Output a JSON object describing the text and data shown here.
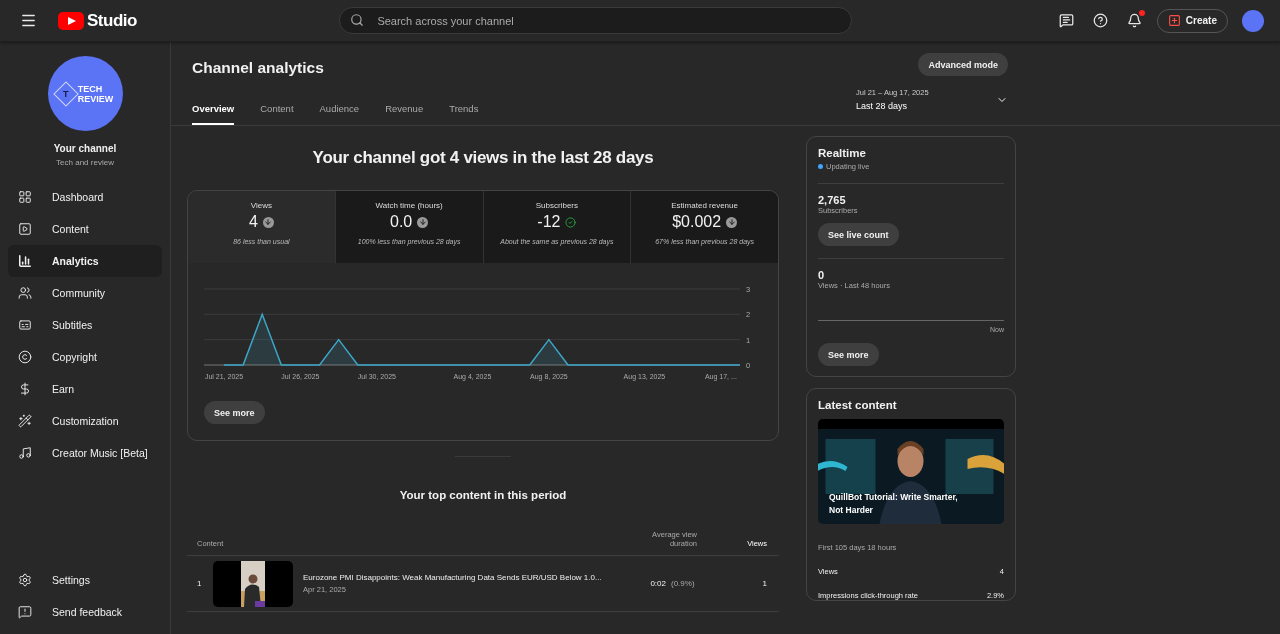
{
  "topbar": {
    "logo_text": "Studio",
    "search": {
      "placeholder": "Search across your channel"
    },
    "notification_dot": true,
    "create_button": "Create"
  },
  "sidebar": {
    "avatar_mark": "T",
    "avatar_lines": [
      "TECH",
      "REVIEW"
    ],
    "channel_title": "Your channel",
    "channel_subtitle": "Tech and review",
    "items": [
      {
        "label": "Dashboard",
        "selected": false
      },
      {
        "label": "Content",
        "selected": false
      },
      {
        "label": "Analytics",
        "selected": true
      },
      {
        "label": "Community",
        "selected": false
      },
      {
        "label": "Subtitles",
        "selected": false
      },
      {
        "label": "Copyright",
        "selected": false
      },
      {
        "label": "Earn",
        "selected": false
      },
      {
        "label": "Customization",
        "selected": false
      },
      {
        "label": "Creator Music [Beta]",
        "selected": false
      }
    ],
    "bottom_items": [
      {
        "label": "Settings"
      },
      {
        "label": "Send feedback"
      }
    ]
  },
  "header": {
    "title": "Channel analytics",
    "advanced_button": "Advanced mode",
    "date_range": "Jul 21 – Aug 17, 2025",
    "date_label": "Last 28 days",
    "tabs": [
      {
        "label": "Overview",
        "selected": true
      },
      {
        "label": "Content",
        "selected": false
      },
      {
        "label": "Audience",
        "selected": false
      },
      {
        "label": "Revenue",
        "selected": false
      },
      {
        "label": "Trends",
        "selected": false
      }
    ]
  },
  "overview": {
    "headline": "Your channel got 4 views in the last 28 days",
    "stats": [
      {
        "label": "Views",
        "value": "4",
        "kind": "down",
        "note": "86 less than usual",
        "selected": true
      },
      {
        "label": "Watch time (hours)",
        "value": "0.0",
        "kind": "down",
        "note": "100% less than previous 28 days",
        "selected": false
      },
      {
        "label": "Subscribers",
        "value": "-12",
        "kind": "check",
        "note": "About the same as previous 28 days",
        "selected": false
      },
      {
        "label": "Estimated revenue",
        "value": "$0.002",
        "kind": "down",
        "note": "67% less than previous 28 days",
        "selected": false
      }
    ],
    "chart_data": {
      "type": "area",
      "categories": [
        "Jul 21, 2025",
        null,
        null,
        null,
        "Jul 26, 2025",
        null,
        null,
        null,
        "Jul 30, 2025",
        null,
        null,
        null,
        null,
        "Aug 4, 2025",
        null,
        null,
        null,
        "Aug 8, 2025",
        null,
        null,
        null,
        null,
        "Aug 13, 2025",
        null,
        null,
        null,
        "Aug 17, ...",
        null
      ],
      "values": [
        0,
        0,
        2,
        0,
        0,
        0,
        1,
        0,
        0,
        0,
        0,
        0,
        0,
        0,
        0,
        0,
        0,
        1,
        0,
        0,
        0,
        0,
        0,
        0,
        0,
        0,
        0,
        0
      ],
      "ylim": [
        0,
        3
      ],
      "yticks": [
        0,
        1,
        2,
        3
      ]
    },
    "see_more": "See more"
  },
  "top_content": {
    "title": "Your top content in this period",
    "columns": [
      "Content",
      "Average view duration",
      "Views"
    ],
    "rows": [
      {
        "rank": "1",
        "title": "Eurozone PMI Disappoints: Weak Manufacturing Data Sends EUR/USD Below 1.0...",
        "date": "Apr 21, 2025",
        "duration": "0:02",
        "percent": "(0.9%)",
        "views": "1"
      }
    ]
  },
  "realtime": {
    "title": "Realtime",
    "status": "Updating live",
    "subscribers": "2,765",
    "subscribers_label": "Subscribers",
    "live_button": "See live count",
    "views": "0",
    "views_label": "Views · Last 48 hours",
    "axis_label": "Now",
    "see_more": "See more"
  },
  "latest": {
    "title": "Latest content",
    "video_title": "QuillBot Tutorial: Write Smarter, Not Harder",
    "period": "First 105 days 18 hours",
    "metrics": [
      {
        "label": "Views",
        "value": "4"
      },
      {
        "label": "Impressions click-through rate",
        "value": "2.9%"
      }
    ]
  }
}
